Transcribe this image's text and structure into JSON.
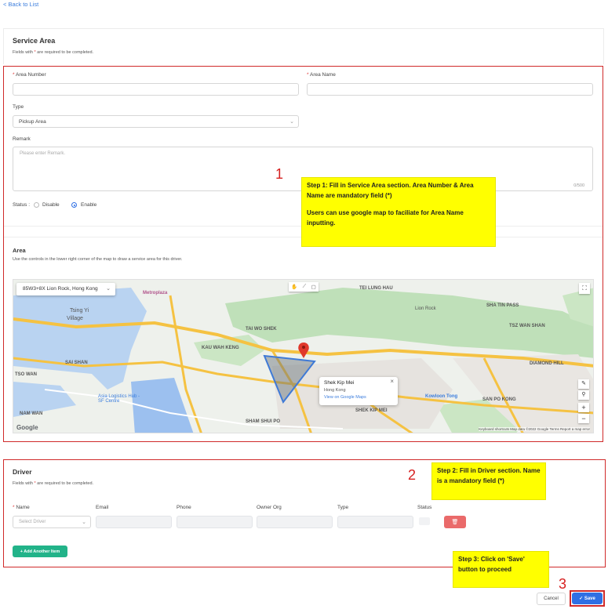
{
  "nav": {
    "back": "< Back to List"
  },
  "service_area": {
    "title": "Service Area",
    "subtitle_pre": "Fields with ",
    "subtitle_star": "*",
    "subtitle_post": " are required to be completed.",
    "area_number_label": "Area Number",
    "area_name_label": "Area Name",
    "type_label": "Type",
    "type_value": "Pickup Area",
    "remark_label": "Remark",
    "remark_placeholder": "Please enter Remark.",
    "remark_counter": "0/500",
    "status_label": "Status :",
    "status_disable": "Disable",
    "status_enable": "Enable",
    "status_value": "Enable"
  },
  "area": {
    "title": "Area",
    "subtitle": "Use the controls in the lower right corner of the map to draw a service area for this driver.",
    "location_value": "85W3+8X Lion Rock, Hong Kong",
    "labels": {
      "tei_lung_hau": "TEI LUNG HAU",
      "tsing_yi": "Tsing Yi",
      "village": "Village",
      "metroplaza": "Metroplaza",
      "lion_rock": "Lion Rock",
      "kau_wah_keng": "KAU WAH KENG",
      "tai_wo_shek": "TAI WO SHEK",
      "sai_shan": "SAI SHAN",
      "tsuen_wan": "TSO WAN",
      "shek_kip_mei": "SHEK KIP MEI",
      "diamond_hill": "DIAMOND HILL",
      "tsz_wan_shan": "TSZ WAN SHAN",
      "sha_tin_pass": "SHA TIN PASS",
      "nam_wan": "NAM WAN",
      "sham_shui_po": "SHAM SHUI PO",
      "san_po_kong": "SAN PO KONG",
      "kowloon_tong": "Kowloon Tong",
      "asia_logistics": "Asia Logistics Hub - SF Centre"
    },
    "popup_title": "Shek Kip Mei",
    "popup_sub": "Hong Kong",
    "popup_link": "View on Google Maps",
    "close_icon": "×",
    "google": "Google",
    "attribution": "Keyboard shortcuts   Map data ©2022 Google   Terms   Report a map error"
  },
  "driver": {
    "title": "Driver",
    "subtitle_pre": "Fields with ",
    "subtitle_star": "*",
    "subtitle_post": " are required to be completed.",
    "columns": [
      "Name",
      "Email",
      "Phone",
      "Owner Org",
      "Type",
      "Status"
    ],
    "name_placeholder": "Select Driver",
    "add_item": "+ Add Another Item"
  },
  "footer": {
    "cancel": "Cancel",
    "save": "✓ Save"
  },
  "callouts": {
    "step1_num": "1",
    "step1_line1": "Step 1: Fill in Service Area section. Area Number & Area Name are mandatory field (*)",
    "step1_line2": "Users can use google map to faciliate for Area Name inputting.",
    "step2_num": "2",
    "step2_text": "Step 2: Fill in Driver section. Name is a mandatory field (*)",
    "step3_num": "3",
    "step3_text": "Step 3: Click on 'Save' button to proceed"
  },
  "colors": {
    "accent": "#2f6fe4",
    "add": "#22b389",
    "delete": "#ea6a6a",
    "annotation": "#ffff00",
    "annotation_border": "#d02a2a"
  }
}
